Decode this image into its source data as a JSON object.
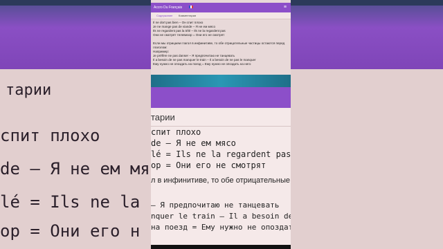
{
  "app": {
    "title": "Accro Du Français",
    "menu_icon": "hamburger-icon"
  },
  "tabs": [
    {
      "label": "Содержание"
    },
    {
      "label": "Комментарии"
    }
  ],
  "content_lines": [
    "Il ne dort pas bien – Он спит плохо",
    "Je ne mange pas de viande – Я не ем мясо",
    "Ils ne regardent pas la télé – Ils ne la regardent pas",
    "Они не смотрят телевизор = Они его не смотрят",
    "",
    "Если мы отрицаем глагол в инфинитиве, то обе отрицательные частицы остаются перед глаголом:",
    "Например:",
    "Je préfère ne pas danser – Я предпочитаю не танцевать",
    "Il a besoin de ne pas manquer le train – Il a besoin de ne pas le manquer",
    "Ему нужно не опоздать на поезд = Ему нужно не опоздать на него"
  ],
  "zoom": {
    "title": "тарии",
    "lines": [
      "спит плохо",
      "de – Я не ем мясо",
      "lé = Ils ne la regardent pas",
      "op = Они его не смотрят",
      "л в инфинитиве, то обе отрицательные ча",
      "– Я предпочитаю не танцевать",
      "nquer le train – Il a besoin de ne pas le ma",
      "на поезд = Ему нужно не опоздать на него"
    ]
  },
  "background": {
    "lines": [
      "тарии",
      "спит плохо",
      "de – Я не ем мясо",
      "lé = Ils ne la re",
      "op = Они его н"
    ]
  },
  "colors": {
    "accent_purple": "#8c4fc9",
    "teal": "#2a97b4",
    "content_bg": "#e8d9d9"
  }
}
